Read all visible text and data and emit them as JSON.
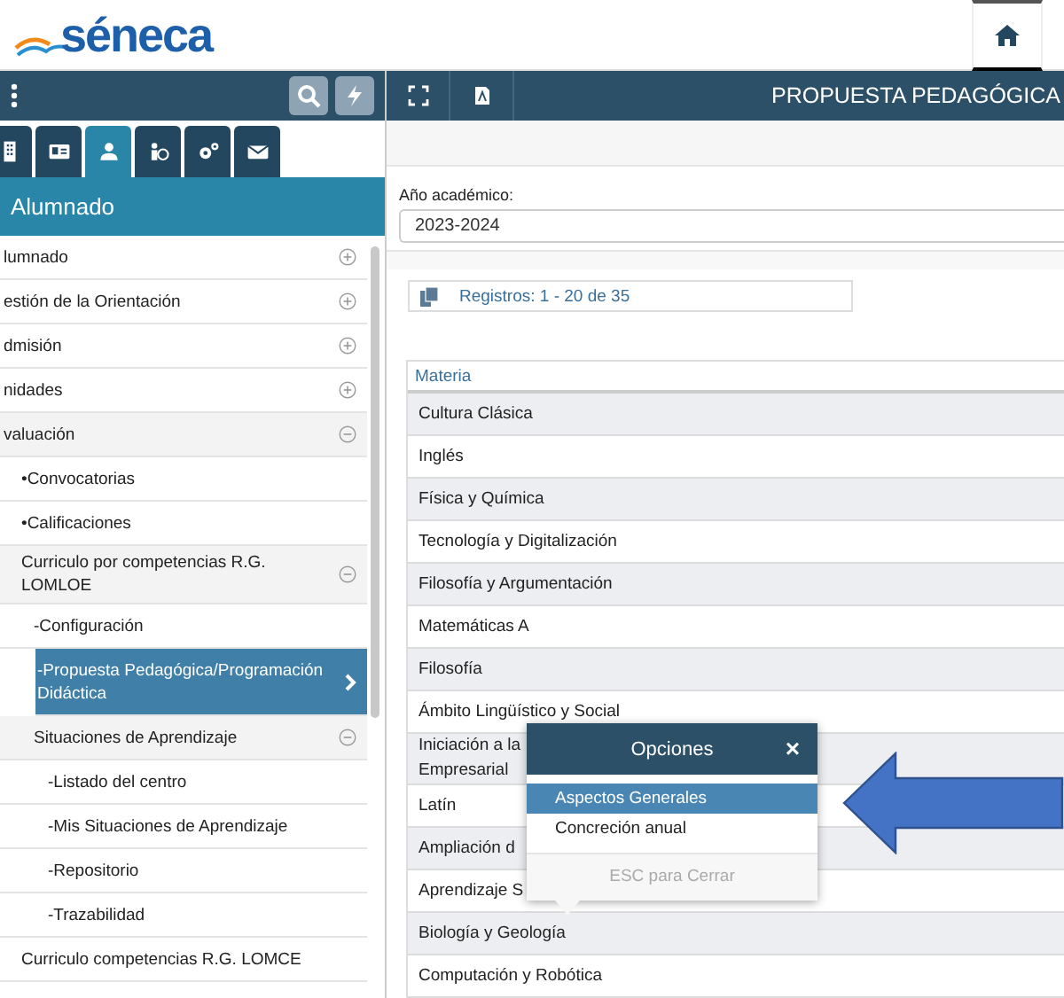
{
  "logo": {
    "text": "séneca"
  },
  "sidebar": {
    "tabs": [
      {
        "kind": "building",
        "selected": false
      },
      {
        "kind": "idcard",
        "selected": false
      },
      {
        "kind": "users",
        "selected": true
      },
      {
        "kind": "people",
        "selected": false
      },
      {
        "kind": "gears",
        "selected": false
      },
      {
        "kind": "mail",
        "selected": false
      }
    ],
    "section_title": "Alumnado",
    "tree": [
      {
        "label": "lumnado",
        "expanded": false,
        "selected": false
      },
      {
        "label": "estión de la Orientación",
        "expanded": false,
        "selected": false
      },
      {
        "label": "dmisión",
        "expanded": false,
        "selected": false
      },
      {
        "label": "nidades",
        "expanded": false,
        "selected": false
      },
      {
        "label": "valuación",
        "expanded": true,
        "selected": false,
        "children": [
          {
            "label": "•Convocatorias",
            "selected": false
          },
          {
            "label": "•Calificaciones",
            "selected": false
          },
          {
            "label": "Curriculo por competencias R.G. LOMLOE",
            "expanded": true,
            "selected": false,
            "children": [
              {
                "label": "-Configuración",
                "selected": false
              },
              {
                "label": "-Propuesta Pedagógica/Programación Didáctica",
                "selected": true
              },
              {
                "label": "Situaciones de Aprendizaje",
                "expanded": true,
                "selected": false,
                "children": [
                  {
                    "label": "-Listado del centro",
                    "selected": false
                  },
                  {
                    "label": "-Mis Situaciones de Aprendizaje",
                    "selected": false
                  },
                  {
                    "label": "-Repositorio",
                    "selected": false
                  },
                  {
                    "label": "-Trazabilidad",
                    "selected": false
                  }
                ]
              }
            ]
          },
          {
            "label": "Curriculo competencias R.G. LOMCE",
            "selected": false
          }
        ]
      }
    ]
  },
  "page_title": "PROPUESTA PEDAGÓGICA",
  "academic_year": {
    "label": "Año académico:",
    "value": "2023-2024"
  },
  "records": "Registros: 1 - 20 de 35",
  "table": {
    "columns": [
      "Materia"
    ],
    "rows": [
      {
        "lines": [
          "Cultura Clásica"
        ]
      },
      {
        "lines": [
          "Inglés"
        ]
      },
      {
        "lines": [
          "Física y Química"
        ]
      },
      {
        "lines": [
          "Tecnología y Digitalización"
        ]
      },
      {
        "lines": [
          "Filosofía y Argumentación"
        ]
      },
      {
        "lines": [
          "Matemáticas A"
        ]
      },
      {
        "lines": [
          "Filosofía"
        ]
      },
      {
        "lines": [
          "Ámbito Lingüístico y Social"
        ]
      },
      {
        "lines": [
          "Iniciación a la",
          "Empresarial"
        ]
      },
      {
        "lines": [
          "Latín"
        ]
      },
      {
        "lines": [
          "Ampliación d"
        ]
      },
      {
        "lines": [
          "Aprendizaje S"
        ]
      },
      {
        "lines": [
          "Biología y Geología"
        ]
      },
      {
        "lines": [
          "Computación y Robótica"
        ]
      }
    ]
  },
  "popup": {
    "title": "Opciones",
    "close": "×",
    "options": [
      {
        "label": "Aspectos Generales",
        "selected": true
      },
      {
        "label": "Concreción anual",
        "selected": false
      }
    ],
    "footer": "ESC para Cerrar"
  }
}
